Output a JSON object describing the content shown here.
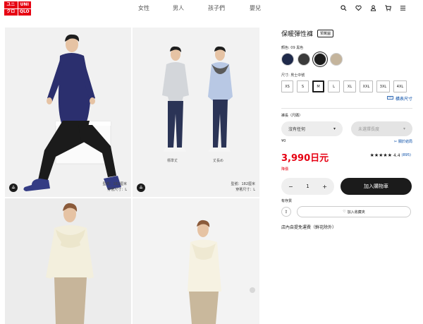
{
  "header": {
    "logo": [
      "UNI",
      "UNI",
      "QLO",
      "QLO"
    ],
    "logo_top": [
      "ユニ",
      "UNI"
    ],
    "logo_bottom": [
      "クロ",
      "QLO"
    ],
    "nav": [
      "女性",
      "男人",
      "孩子們",
      "嬰兒"
    ],
    "icons": [
      "search-icon",
      "heart-icon",
      "user-icon",
      "cart-icon",
      "menu-icon"
    ]
  },
  "gallery": {
    "tile1_note": [
      "型號：182厘米",
      "穿著尺寸：L"
    ],
    "tile2_note": [
      "型號：182厘米",
      "穿著尺寸：L"
    ],
    "tile2_captions": [
      "標準丈",
      "丈長め"
    ]
  },
  "product": {
    "title": "保暖彈性褲",
    "tag": "預覽圖",
    "color_label": "顏色: 09 黑色",
    "colors": [
      "#1f2a4a",
      "#3b3b3b",
      "#1b1b1b",
      "#c4b49c"
    ],
    "size_label": "尺寸: 男士中號",
    "sizes": [
      "XS",
      "S",
      "M",
      "L",
      "XL",
      "XXL",
      "3XL",
      "4XL"
    ],
    "size_guide": "橫表尺寸",
    "alter_label": "褲長（尺碼）",
    "alter_option": "沒有任何",
    "alter_option2": "未選擇長度",
    "alter_price": "¥0",
    "alter_result": "關於結局",
    "price": "3,990日元",
    "rating_value": "4.4",
    "rating_count": "(895)",
    "sale_label": "降價",
    "qty": "1",
    "cart_label": "加入購物車",
    "stock_label": "有存貨",
    "fav_label": "加入收藏夾",
    "store_info": "店內自提免運費（鮮花除外）"
  }
}
